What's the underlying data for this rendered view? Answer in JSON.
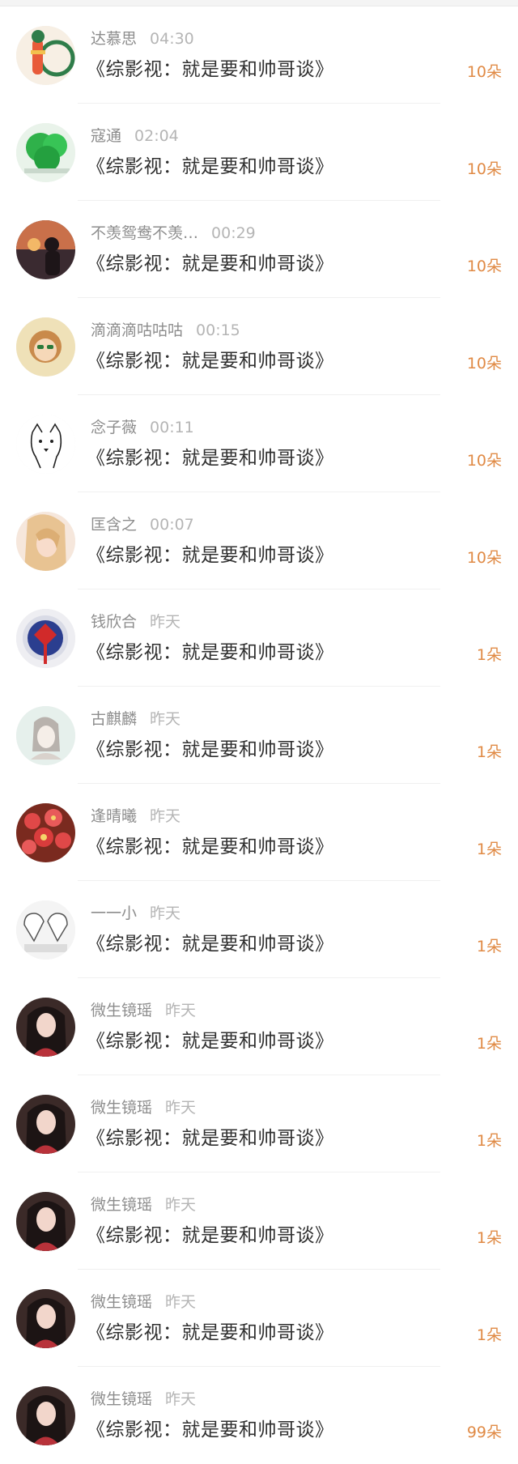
{
  "list": {
    "items": [
      {
        "name": "达慕思",
        "time": "04:30",
        "message": "《综影视：就是要和帅哥谈》",
        "count": "10朵",
        "avatar_icon": "cartoon-bicycle-avatar"
      },
      {
        "name": "寇通",
        "time": "02:04",
        "message": "《综影视：就是要和帅哥谈》",
        "count": "10朵",
        "avatar_icon": "green-balloon-avatar"
      },
      {
        "name": "不羡鸳鸯不羡…",
        "time": "00:29",
        "message": "《综影视：就是要和帅哥谈》",
        "count": "10朵",
        "avatar_icon": "sunset-girl-avatar"
      },
      {
        "name": "滴滴滴咕咕咕",
        "time": "00:15",
        "message": "《综影视：就是要和帅哥谈》",
        "count": "10朵",
        "avatar_icon": "cartoon-girl-sunglasses-avatar"
      },
      {
        "name": "念子薇",
        "time": "00:11",
        "message": "《综影视：就是要和帅哥谈》",
        "count": "10朵",
        "avatar_icon": "sketch-dog-avatar"
      },
      {
        "name": "匡含之",
        "time": "00:07",
        "message": "《综影视：就是要和帅哥谈》",
        "count": "10朵",
        "avatar_icon": "blonde-girl-avatar"
      },
      {
        "name": "钱欣合",
        "time": "昨天",
        "message": "《综影视：就是要和帅哥谈》",
        "count": "1朵",
        "avatar_icon": "chinese-knot-avatar"
      },
      {
        "name": "古麒麟",
        "time": "昨天",
        "message": "《综影视：就是要和帅哥谈》",
        "count": "1朵",
        "avatar_icon": "sketch-girl-avatar"
      },
      {
        "name": "逢晴曦",
        "time": "昨天",
        "message": "《综影视：就是要和帅哥谈》",
        "count": "1朵",
        "avatar_icon": "red-flowers-avatar"
      },
      {
        "name": "一一小",
        "time": "昨天",
        "message": "《综影视：就是要和帅哥谈》",
        "count": "1朵",
        "avatar_icon": "bw-hearts-avatar"
      },
      {
        "name": "微生镜瑶",
        "time": "昨天",
        "message": "《综影视：就是要和帅哥谈》",
        "count": "1朵",
        "avatar_icon": "portrait-woman-avatar"
      },
      {
        "name": "微生镜瑶",
        "time": "昨天",
        "message": "《综影视：就是要和帅哥谈》",
        "count": "1朵",
        "avatar_icon": "portrait-woman-avatar"
      },
      {
        "name": "微生镜瑶",
        "time": "昨天",
        "message": "《综影视：就是要和帅哥谈》",
        "count": "1朵",
        "avatar_icon": "portrait-woman-avatar"
      },
      {
        "name": "微生镜瑶",
        "time": "昨天",
        "message": "《综影视：就是要和帅哥谈》",
        "count": "1朵",
        "avatar_icon": "portrait-woman-avatar"
      },
      {
        "name": "微生镜瑶",
        "time": "昨天",
        "message": "《综影视：就是要和帅哥谈》",
        "count": "99朵",
        "avatar_icon": "portrait-woman-avatar"
      }
    ]
  },
  "colors": {
    "count": "#e08a45",
    "name": "#8d8d8d",
    "time": "#b5b5b5",
    "message": "#303030"
  }
}
